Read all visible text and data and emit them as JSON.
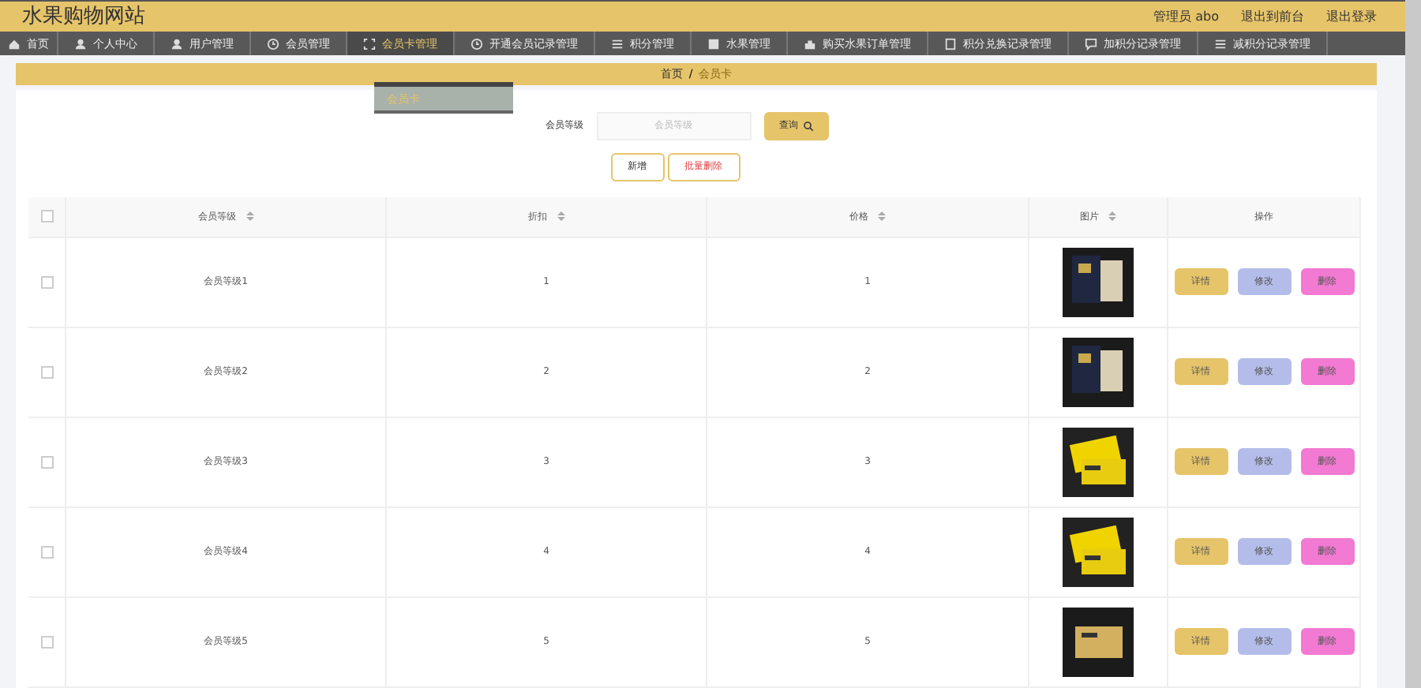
{
  "header": {
    "title": "水果购物网站",
    "links": [
      "管理员 abo",
      "退出到前台",
      "退出登录"
    ]
  },
  "nav": [
    {
      "label": "首页",
      "selected": false
    },
    {
      "label": "个人中心",
      "selected": false
    },
    {
      "label": "用户管理",
      "selected": false
    },
    {
      "label": "会员管理",
      "selected": false
    },
    {
      "label": "会员卡管理",
      "selected": true
    },
    {
      "label": "开通会员记录管理",
      "selected": false
    },
    {
      "label": "积分管理",
      "selected": false
    },
    {
      "label": "水果管理",
      "selected": false
    },
    {
      "label": "购买水果订单管理",
      "selected": false
    },
    {
      "label": "积分兑换记录管理",
      "selected": false
    },
    {
      "label": "加积分记录管理",
      "selected": false
    },
    {
      "label": "减积分记录管理",
      "selected": false
    }
  ],
  "dropdown": {
    "items": [
      "会员卡"
    ]
  },
  "breadcrumb": {
    "items": [
      "首页",
      "会员卡"
    ],
    "separator": "/"
  },
  "search": {
    "label": "会员等级",
    "placeholder": "会员等级",
    "button": "查询"
  },
  "actions": [
    {
      "label": "新增",
      "kind": "add"
    },
    {
      "label": "批量删除",
      "kind": "delete"
    }
  ],
  "table": {
    "columns": [
      "会员等级",
      "折扣",
      "价格",
      "图片",
      "操作"
    ],
    "all_checked": false,
    "rows": [
      {
        "level": "会员等级1",
        "discount": "1",
        "price": "1",
        "checked": false,
        "buttons": [
          {
            "label": "详情",
            "kind": "detail"
          },
          {
            "label": "修改",
            "kind": "edit"
          },
          {
            "label": "删除",
            "kind": "delete"
          }
        ]
      },
      {
        "level": "会员等级2",
        "discount": "2",
        "price": "2",
        "checked": false,
        "buttons": [
          {
            "label": "详情",
            "kind": "detail"
          },
          {
            "label": "修改",
            "kind": "edit"
          },
          {
            "label": "删除",
            "kind": "delete"
          }
        ]
      },
      {
        "level": "会员等级3",
        "discount": "3",
        "price": "3",
        "checked": false,
        "buttons": [
          {
            "label": "详情",
            "kind": "detail"
          },
          {
            "label": "修改",
            "kind": "edit"
          },
          {
            "label": "删除",
            "kind": "delete"
          }
        ]
      },
      {
        "level": "会员等级4",
        "discount": "4",
        "price": "4",
        "checked": false,
        "buttons": [
          {
            "label": "详情",
            "kind": "detail"
          },
          {
            "label": "修改",
            "kind": "edit"
          },
          {
            "label": "删除",
            "kind": "delete"
          }
        ]
      },
      {
        "level": "会员等级5",
        "discount": "5",
        "price": "5",
        "checked": false,
        "buttons": [
          {
            "label": "详情",
            "kind": "detail"
          },
          {
            "label": "修改",
            "kind": "edit"
          },
          {
            "label": "删除",
            "kind": "delete"
          }
        ]
      }
    ]
  }
}
